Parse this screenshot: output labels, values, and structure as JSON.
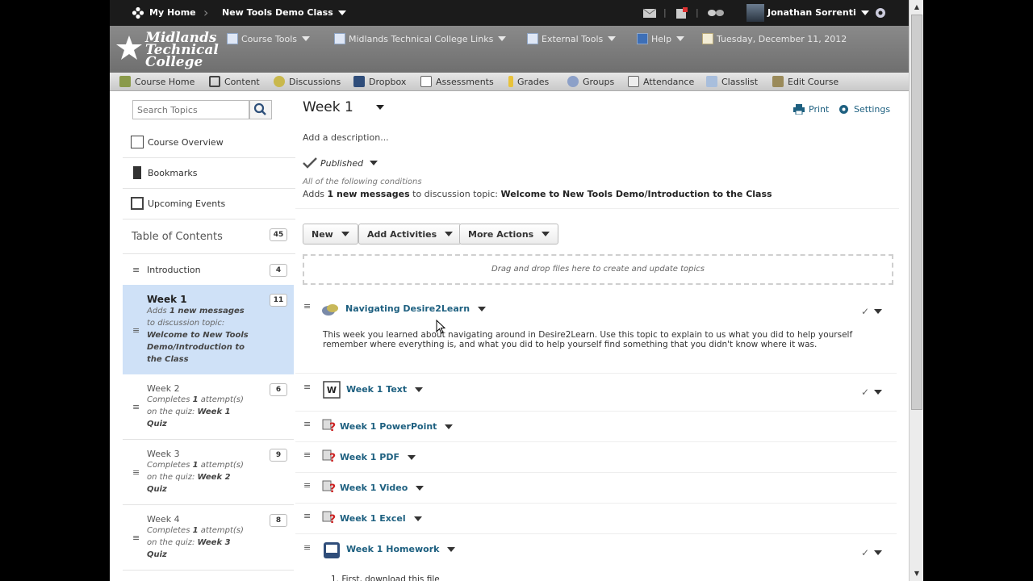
{
  "topbar": {
    "home": "My Home",
    "course": "New Tools Demo Class",
    "user": "Jonathan Sorrenti"
  },
  "header": {
    "logo_line1": "Midlands",
    "logo_line2": "Technical",
    "logo_line3": "College",
    "links": [
      "Course Tools",
      "Midlands Technical College Links",
      "External Tools",
      "Help"
    ],
    "date": "Tuesday, December 11, 2012"
  },
  "nav": [
    "Course Home",
    "Content",
    "Discussions",
    "Dropbox",
    "Assessments",
    "Grades",
    "Groups",
    "Attendance",
    "Classlist",
    "Edit Course"
  ],
  "sidebar": {
    "search_placeholder": "Search Topics",
    "links": [
      "Course Overview",
      "Bookmarks",
      "Upcoming Events"
    ],
    "toc_title": "Table of Contents",
    "toc_count": "45",
    "items": [
      {
        "title": "Introduction",
        "count": "4"
      },
      {
        "title": "Week 1",
        "count": "11",
        "line1": "Adds",
        "line1b": "1 new messages",
        "line2": "to discussion topic:",
        "line3": "Welcome to New Tools",
        "line4": "Demo/Introduction to",
        "line5": "the Class"
      },
      {
        "title": "Week 2",
        "count": "6",
        "line1": "Completes",
        "line1b": "1",
        "line1c": "attempt(s)",
        "line2": "on the quiz:",
        "line2b": "Week 1",
        "line3": "Quiz"
      },
      {
        "title": "Week 3",
        "count": "9",
        "line1": "Completes",
        "line1b": "1",
        "line1c": "attempt(s)",
        "line2": "on the quiz:",
        "line2b": "Week 2",
        "line3": "Quiz"
      },
      {
        "title": "Week 4",
        "count": "8",
        "line1": "Completes",
        "line1b": "1",
        "line1c": "attempt(s)",
        "line2": "on the quiz:",
        "line2b": "Week 3",
        "line3": "Quiz"
      }
    ]
  },
  "main": {
    "title": "Week 1",
    "print": "Print",
    "settings": "Settings",
    "description": "Add a description...",
    "status": "Published",
    "cond_head": "All of the following conditions",
    "cond_a": "Adds",
    "cond_b": "1 new messages",
    "cond_c": "to discussion topic:",
    "cond_d": "Welcome to New Tools Demo/Introduction to the Class",
    "buttons": [
      "New",
      "Add Activities",
      "More Actions"
    ],
    "dropzone": "Drag and drop files here to create and update topics",
    "topics": [
      {
        "name": "Navigating Desire2Learn",
        "body": "This week you learned about navigating around in Desire2Learn. Use this topic to explain to us what you did to help yourself remember where everything is, and what you did to help yourself find something that you didn't know where it was."
      },
      {
        "name": "Week 1 Text"
      },
      {
        "name": "Week 1 PowerPoint"
      },
      {
        "name": "Week 1 PDF"
      },
      {
        "name": "Week 1 Video"
      },
      {
        "name": "Week 1 Excel"
      },
      {
        "name": "Week 1 Homework",
        "body": "1. First, download this file"
      }
    ]
  },
  "colors": {
    "accent": "#1e6080",
    "selected_bg": "#cfe1f7",
    "topbar_bg": "#1b1b1b"
  }
}
